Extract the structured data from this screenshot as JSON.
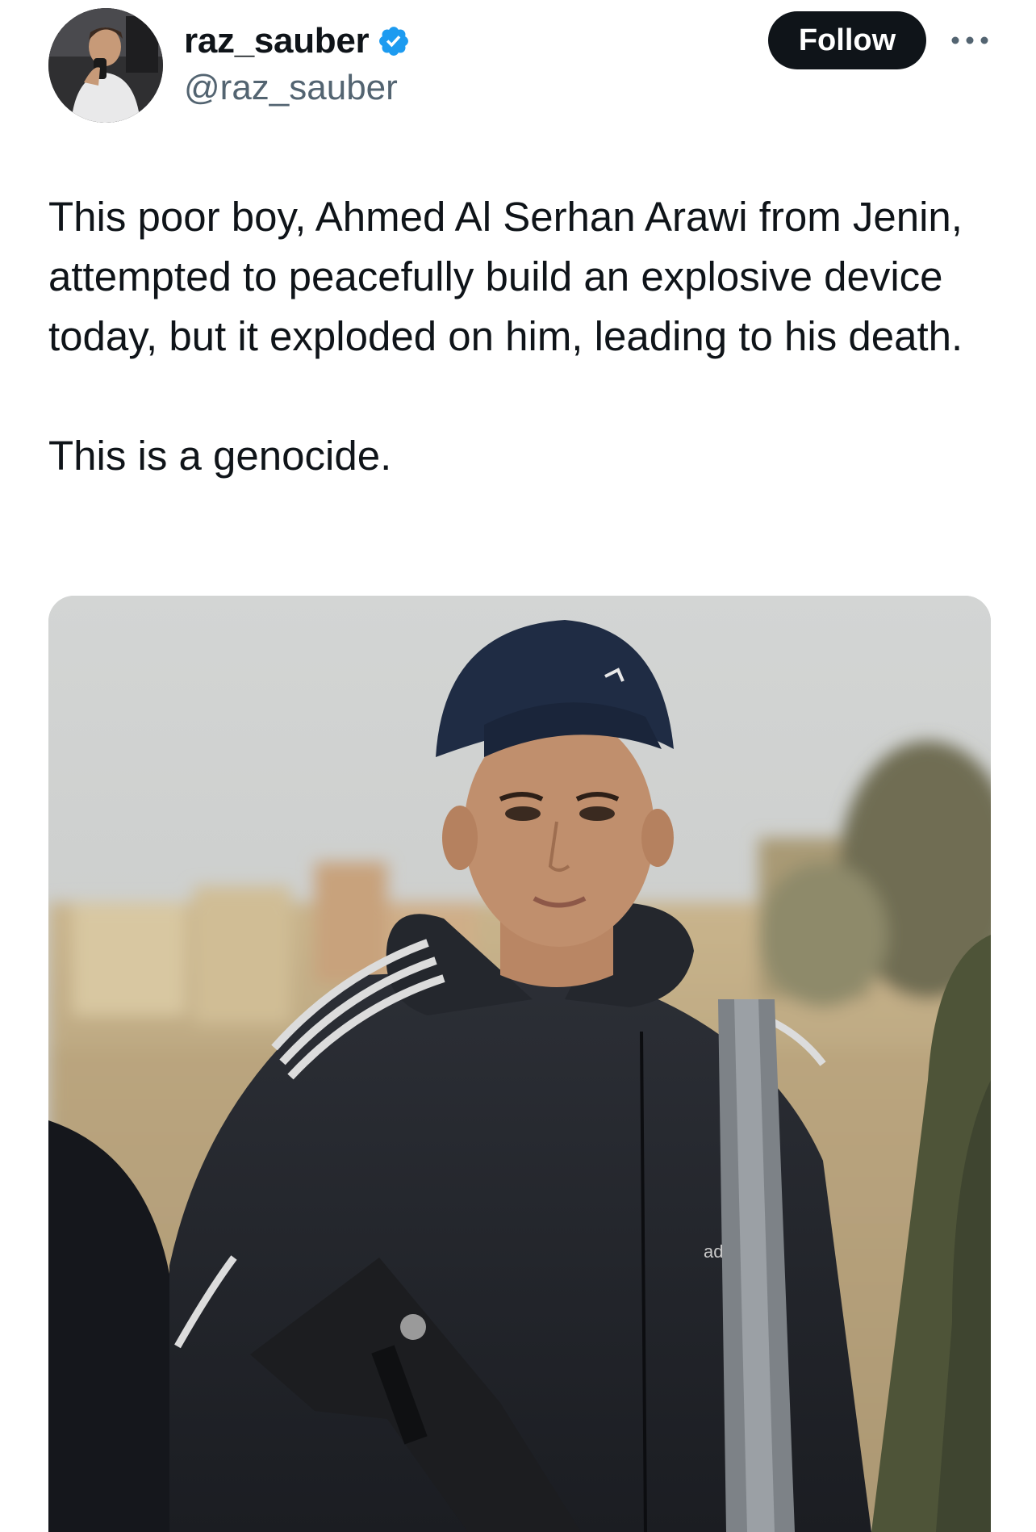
{
  "author": {
    "display_name": "raz_sauber",
    "handle": "@raz_sauber",
    "verified": true,
    "verified_icon": "verified-badge-icon",
    "verified_color": "#1d9bf0"
  },
  "actions": {
    "follow_label": "Follow",
    "more_icon": "more-horizontal-icon"
  },
  "tweet": {
    "paragraph_1": "This poor boy, Ahmed Al Serhan Arawi from Jenin, attempted to peacefully build an explosive device today, but it exploded on him, leading to his death.",
    "paragraph_2": "This is a genocide."
  },
  "media": {
    "kind": "photo",
    "brand_mark": "ad"
  },
  "colors": {
    "text_primary": "#0f1419",
    "text_secondary": "#536471",
    "follow_bg": "#0f1419",
    "follow_fg": "#ffffff"
  }
}
